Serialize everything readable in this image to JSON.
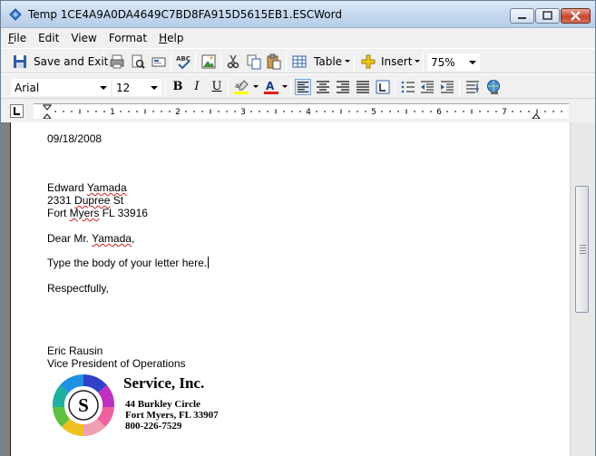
{
  "window": {
    "title": "Temp 1CE4A9A0DA4649C7BD8FA915D5615EB1.ESCWord"
  },
  "menu": [
    {
      "first": "F",
      "rest": "ile"
    },
    {
      "first": "",
      "rest": "Edit"
    },
    {
      "first": "",
      "rest": "View"
    },
    {
      "first": "",
      "rest": "Format"
    },
    {
      "first": "H",
      "rest": "elp"
    }
  ],
  "toolbar": {
    "save_exit_label": "Save and Exit",
    "table_label": "Table",
    "insert_label": "Insert",
    "zoom_value": "75%"
  },
  "format_bar": {
    "font": "Arial",
    "size": "12",
    "bold": "B",
    "italic": "I",
    "underline": "U"
  },
  "ruler": {
    "numbers": [
      "1",
      "2",
      "3",
      "4",
      "5",
      "6",
      "7"
    ]
  },
  "document": {
    "date": "09/18/2008",
    "recipient_name_first": "Edward ",
    "recipient_name_last": "Yamada",
    "address_pre": "2331 ",
    "address_word": "Dupree",
    "address_post": " St",
    "city_pre": "Fort ",
    "city_word": "Myers",
    "city_post": " FL 33916",
    "salutation_pre": "Dear Mr. ",
    "salutation_name": "Yamada",
    "salutation_post": ",",
    "body": "Type the body of your letter here.",
    "closing": "Respectfully,",
    "signer_name": "Eric Rausin",
    "signer_title": "Vice President of Operations"
  },
  "logo": {
    "letter": "S",
    "company": "Service, Inc.",
    "street": "44 Burkley Circle",
    "city": "Fort Myers, FL 33907",
    "phone": "800-226-7529"
  },
  "colors": {
    "accent": "#316ac5",
    "titlebar": "#c4d7ee",
    "close": "#c7462d",
    "spell_underline": "#d02020"
  }
}
